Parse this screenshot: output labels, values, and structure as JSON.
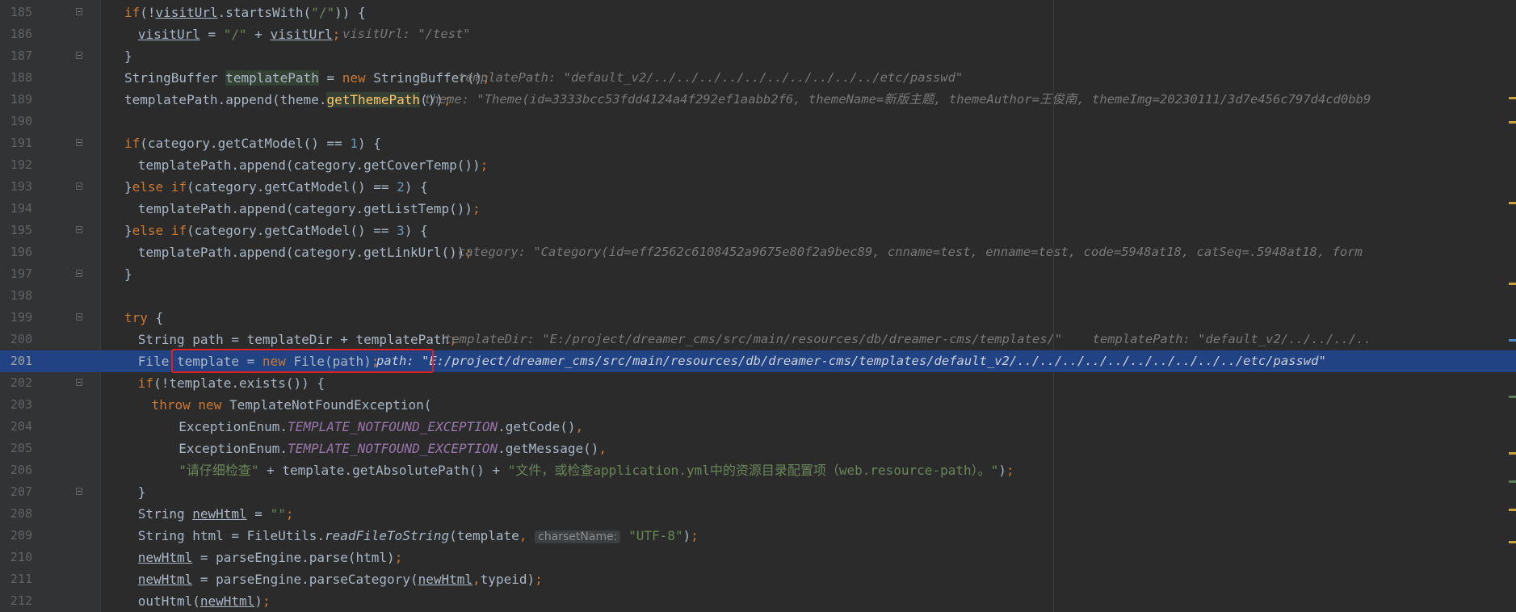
{
  "lines": [
    {
      "num": "185",
      "code": "if(!visitUrl.startsWith(\"/\")) {",
      "hint": ""
    },
    {
      "num": "186",
      "code": "visitUrl = \"/\" + visitUrl;",
      "hint": "visitUrl: \"/test\""
    },
    {
      "num": "187",
      "code": "}",
      "hint": ""
    },
    {
      "num": "188",
      "code": "StringBuffer templatePath = new StringBuffer();",
      "hint": "templatePath: \"default_v2/../../../../../../../../../../etc/passwd\""
    },
    {
      "num": "189",
      "code": "templatePath.append(theme.getThemePath());",
      "hint": "theme: \"Theme(id=3333bcc53fdd4124a4f292ef1aabb2f6, themeName=新版主题, themeAuthor=王俊南, themeImg=20230111/3d7e456c797d4cd0bb9"
    },
    {
      "num": "190",
      "code": "",
      "hint": ""
    },
    {
      "num": "191",
      "code": "if(category.getCatModel() == 1) {",
      "hint": ""
    },
    {
      "num": "192",
      "code": "templatePath.append(category.getCoverTemp());",
      "hint": ""
    },
    {
      "num": "193",
      "code": "}else if(category.getCatModel() == 2) {",
      "hint": ""
    },
    {
      "num": "194",
      "code": "templatePath.append(category.getListTemp());",
      "hint": ""
    },
    {
      "num": "195",
      "code": "}else if(category.getCatModel() == 3) {",
      "hint": ""
    },
    {
      "num": "196",
      "code": "templatePath.append(category.getLinkUrl());",
      "hint": "category: \"Category(id=eff2562c6108452a9675e80f2a9bec89, cnname=test, enname=test, code=5948at18, catSeq=.5948at18, form"
    },
    {
      "num": "197",
      "code": "}",
      "hint": ""
    },
    {
      "num": "198",
      "code": "",
      "hint": ""
    },
    {
      "num": "199",
      "code": "try {",
      "hint": ""
    },
    {
      "num": "200",
      "code": "String path = templateDir + templatePath;",
      "hint": "templateDir: \"E:/project/dreamer_cms/src/main/resources/db/dreamer-cms/templates/\"    templatePath: \"default_v2/../../../.."
    },
    {
      "num": "201",
      "code": "File template = new File(path);",
      "hint": "path: \"E:/project/dreamer_cms/src/main/resources/db/dreamer-cms/templates/default_v2/../../../../../../../../../../etc/passwd\""
    },
    {
      "num": "202",
      "code": "if(!template.exists()) {",
      "hint": ""
    },
    {
      "num": "203",
      "code": "throw new TemplateNotFoundException(",
      "hint": ""
    },
    {
      "num": "204",
      "code": "ExceptionEnum.TEMPLATE_NOTFOUND_EXCEPTION.getCode(),",
      "hint": ""
    },
    {
      "num": "205",
      "code": "ExceptionEnum.TEMPLATE_NOTFOUND_EXCEPTION.getMessage(),",
      "hint": ""
    },
    {
      "num": "206",
      "code": "\"请仔细检查\" + template.getAbsolutePath() + \"文件，或检查application.yml中的资源目录配置项（web.resource-path）。\");",
      "hint": ""
    },
    {
      "num": "207",
      "code": "}",
      "hint": ""
    },
    {
      "num": "208",
      "code": "String newHtml = \"\";",
      "hint": ""
    },
    {
      "num": "209",
      "code": "String html = FileUtils.readFileToString(template, charsetName: \"UTF-8\");",
      "hint": ""
    },
    {
      "num": "210",
      "code": "newHtml = parseEngine.parse(html);",
      "hint": ""
    },
    {
      "num": "211",
      "code": "newHtml = parseEngine.parseCategory(newHtml,typeid);",
      "hint": ""
    },
    {
      "num": "212",
      "code": "outHtml(newHtml);",
      "hint": ""
    }
  ],
  "current_line": "201",
  "param_hint_label": "charsetName:",
  "colors": {
    "background": "#2b2b2b",
    "gutter": "#313335",
    "current_line": "#214283",
    "keyword": "#cc7832",
    "string": "#6a8759",
    "number": "#6897bb",
    "method": "#ffc66d",
    "static_field": "#9876aa",
    "highlight_box": "#e02020"
  }
}
